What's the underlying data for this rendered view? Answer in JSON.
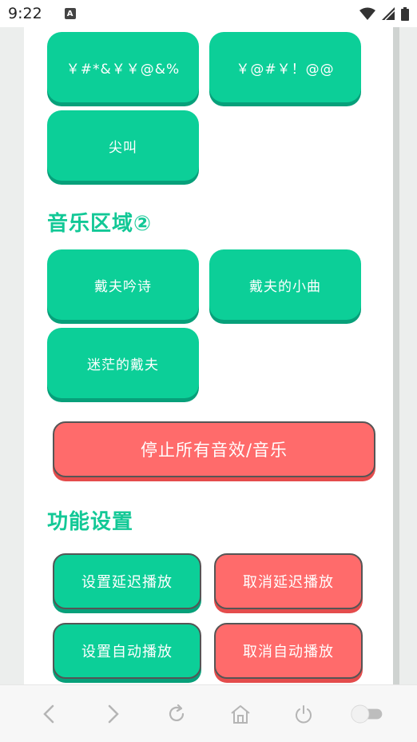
{
  "status_bar": {
    "time": "9:22",
    "notification_glyph": "A"
  },
  "effects_buttons": [
    {
      "label": "￥#*&￥￥@&%"
    },
    {
      "label": "￥@#￥！@@"
    },
    {
      "label": "尖叫"
    }
  ],
  "music_section": {
    "title": "音乐区域②",
    "buttons": [
      {
        "label": "戴夫吟诗"
      },
      {
        "label": "戴夫的小曲"
      },
      {
        "label": "迷茫的戴夫"
      }
    ]
  },
  "stop_button": {
    "label": "停止所有音效/音乐"
  },
  "function_section": {
    "title": "功能设置",
    "buttons": [
      {
        "label": "设置延迟播放",
        "color": "#0ccf98"
      },
      {
        "label": "取消延迟播放",
        "color": "#ff6b6b"
      },
      {
        "label": "设置自动播放",
        "color": "#0ccf98"
      },
      {
        "label": "取消自动播放",
        "color": "#ff6b6b"
      }
    ]
  },
  "nav_bar": {
    "icons": [
      "back-icon",
      "forward-icon",
      "refresh-icon",
      "home-icon",
      "power-icon",
      "toggle-switch"
    ]
  },
  "colors": {
    "accent_green": "#0ccf98",
    "accent_red": "#ff6b6b",
    "title_green": "#12c896"
  }
}
